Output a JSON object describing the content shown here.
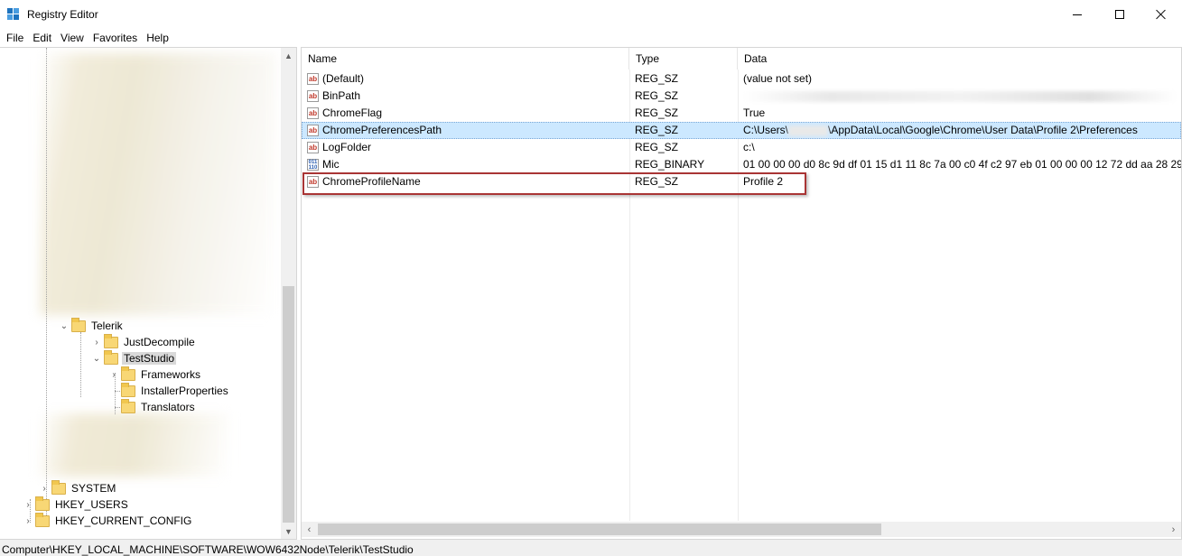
{
  "window": {
    "title": "Registry Editor",
    "icon": "registry-editor-icon"
  },
  "menu": [
    "File",
    "Edit",
    "View",
    "Favorites",
    "Help"
  ],
  "tree": {
    "nodes": [
      {
        "label": "Telerik",
        "expanded": true
      },
      {
        "label": "JustDecompile",
        "expanded": false
      },
      {
        "label": "TestStudio",
        "expanded": true,
        "selected": true
      },
      {
        "label": "Frameworks",
        "expanded": false
      },
      {
        "label": "InstallerProperties"
      },
      {
        "label": "Translators"
      },
      {
        "label": "SYSTEM",
        "expanded": false
      },
      {
        "label": "HKEY_USERS",
        "expanded": false
      },
      {
        "label": "HKEY_CURRENT_CONFIG",
        "expanded": false
      }
    ]
  },
  "list": {
    "columns": [
      "Name",
      "Type",
      "Data"
    ],
    "rows": [
      {
        "name": "(Default)",
        "type": "REG_SZ",
        "data": "(value not set)",
        "icon": "string-value-icon"
      },
      {
        "name": "BinPath",
        "type": "REG_SZ",
        "data": "",
        "icon": "string-value-icon"
      },
      {
        "name": "ChromeFlag",
        "type": "REG_SZ",
        "data": "True",
        "icon": "string-value-icon"
      },
      {
        "name": "ChromePreferencesPath",
        "type": "REG_SZ",
        "data_prefix": "C:\\Users\\",
        "data_suffix": "\\AppData\\Local\\Google\\Chrome\\User Data\\Profile 2\\Preferences",
        "icon": "string-value-icon",
        "selected": true
      },
      {
        "name": "LogFolder",
        "type": "REG_SZ",
        "data": "c:\\",
        "icon": "string-value-icon"
      },
      {
        "name": "Mic",
        "type": "REG_BINARY",
        "data": "01 00 00 00 d0 8c 9d df 01 15 d1 11 8c 7a 00 c0 4f c2 97 eb 01 00 00 00 12 72 dd aa 28 29 4e 46 9",
        "icon": "binary-value-icon"
      },
      {
        "name": "ChromeProfileName",
        "type": "REG_SZ",
        "data": "Profile 2",
        "icon": "string-value-icon"
      }
    ]
  },
  "status": {
    "path": "Computer\\HKEY_LOCAL_MACHINE\\SOFTWARE\\WOW6432Node\\Telerik\\TestStudio"
  },
  "colors": {
    "selection": "#cce8ff",
    "highlight_box": "#a93535",
    "folder": "#f8d775"
  }
}
